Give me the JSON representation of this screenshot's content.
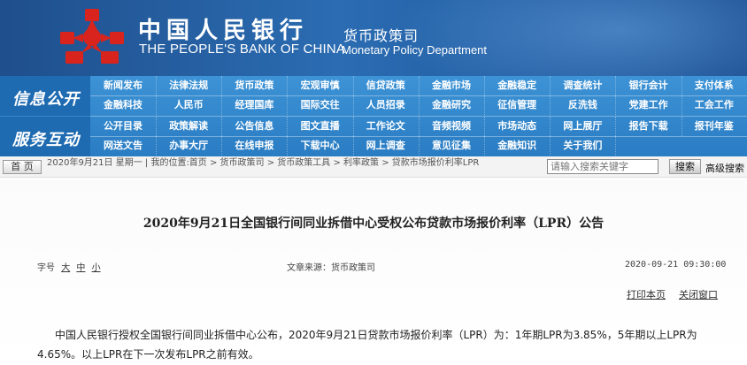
{
  "header": {
    "cn_name": "中国人民银行",
    "en_name": "THE PEOPLE'S BANK OF CHINA",
    "dept_cn": "货币政策司",
    "dept_en": "Monetary Policy Department",
    "logo_icon": "pboc-logo-icon",
    "logo_color": "#d8241c",
    "banner_color": "#1f4f8c"
  },
  "nav": {
    "section1_label": "信息公开",
    "section2_label": "服务互动",
    "rows": [
      [
        "新闻发布",
        "法律法规",
        "货币政策",
        "宏观审慎",
        "信贷政策",
        "金融市场",
        "金融稳定",
        "调查统计",
        "银行会计",
        "支付体系"
      ],
      [
        "金融科技",
        "人民币",
        "经理国库",
        "国际交往",
        "人员招录",
        "金融研究",
        "征信管理",
        "反洗钱",
        "党建工作",
        "工会工作"
      ],
      [
        "公开目录",
        "政策解读",
        "公告信息",
        "图文直播",
        "工作论文",
        "音频视频",
        "市场动态",
        "网上展厅",
        "报告下载",
        "报刊年鉴"
      ],
      [
        "网送文告",
        "办事大厅",
        "在线申报",
        "下载中心",
        "网上调查",
        "意见征集",
        "金融知识",
        "关于我们"
      ]
    ]
  },
  "crumb": {
    "home": "首 页",
    "text": "2020年9月21日 星期一 | 我的位置:首页 > 货币政策司 > 货币政策工具 > 利率政策 > 贷款市场报价利率LPR",
    "search_placeholder": "请输入搜索关键字",
    "search_button": "搜索",
    "advanced_search": "高级搜索"
  },
  "article": {
    "title": "2020年9月21日全国银行间同业拆借中心受权公布贷款市场报价利率（LPR）公告",
    "fontsize_label": "字号",
    "fontsize_large": "大",
    "fontsize_medium": "中",
    "fontsize_small": "小",
    "source": "文章来源：货币政策司",
    "datetime": "2020-09-21 09:30:00",
    "print": "打印本页",
    "close": "关闭窗口",
    "body": "中国人民银行授权全国银行间同业拆借中心公布，2020年9月21日贷款市场报价利率（LPR）为：1年期LPR为3.85%，5年期以上LPR为4.65%。以上LPR在下一次发布LPR之前有效。"
  }
}
